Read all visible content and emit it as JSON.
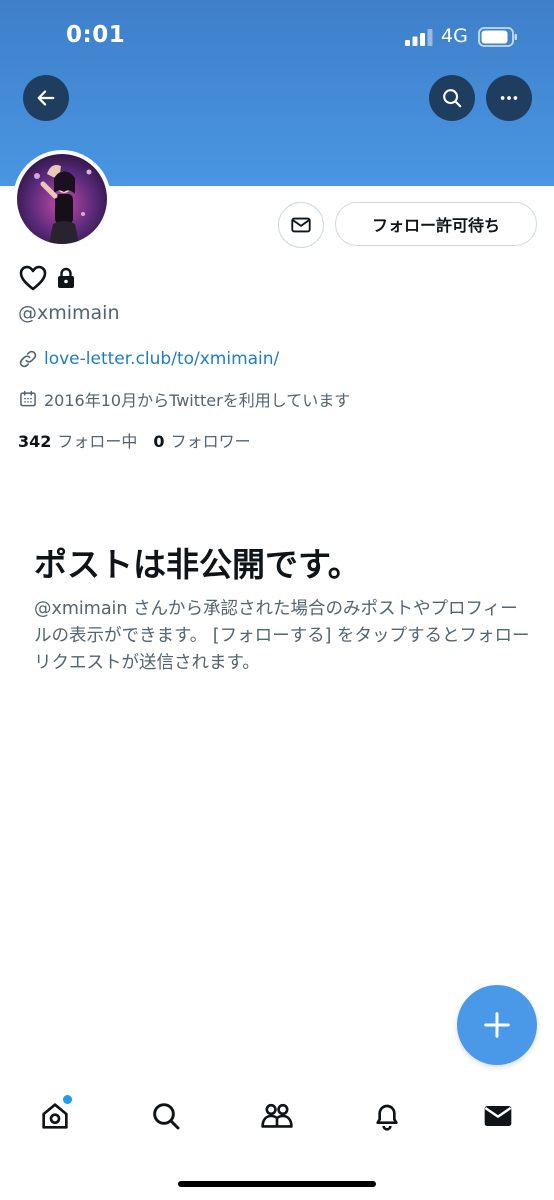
{
  "status_bar": {
    "time": "0:01",
    "network": "4G",
    "signal_icon": "signal-bars-icon",
    "battery_icon": "battery-icon"
  },
  "header": {
    "back_icon": "arrow-left-icon",
    "search_icon": "search-icon",
    "more_icon": "more-horizontal-icon",
    "banner_color": "#4996e2"
  },
  "profile": {
    "avatar_icon": "avatar-photo",
    "display_name_icons": [
      "heart-outline-icon",
      "lock-icon"
    ],
    "handle": "@xmimain",
    "link": "love-letter.club/to/xmimain/",
    "joined": "2016年10月からTwitterを利用しています",
    "following_count": "342",
    "following_label": "フォロー中",
    "followers_count": "0",
    "followers_label": "フォロワー"
  },
  "actions": {
    "message_icon": "envelope-icon",
    "follow_button_label": "フォロー許可待ち"
  },
  "private_notice": {
    "title": "ポストは非公開です。",
    "description": "@xmimain さんから承認された場合のみポストやプロフィールの表示ができます。 [フォローする] をタップするとフォローリクエストが送信されます。"
  },
  "fab": {
    "icon": "plus-icon",
    "color": "#4a99e9"
  },
  "bottom_nav": {
    "items": [
      {
        "icon": "home-icon",
        "has_badge": true
      },
      {
        "icon": "search-icon"
      },
      {
        "icon": "communities-icon"
      },
      {
        "icon": "bell-icon"
      },
      {
        "icon": "envelope-icon"
      }
    ]
  },
  "colors": {
    "link": "#1d7dc6",
    "secondary_text": "#536471",
    "primary_text": "#0f1419",
    "badge": "#1d9bf0"
  }
}
